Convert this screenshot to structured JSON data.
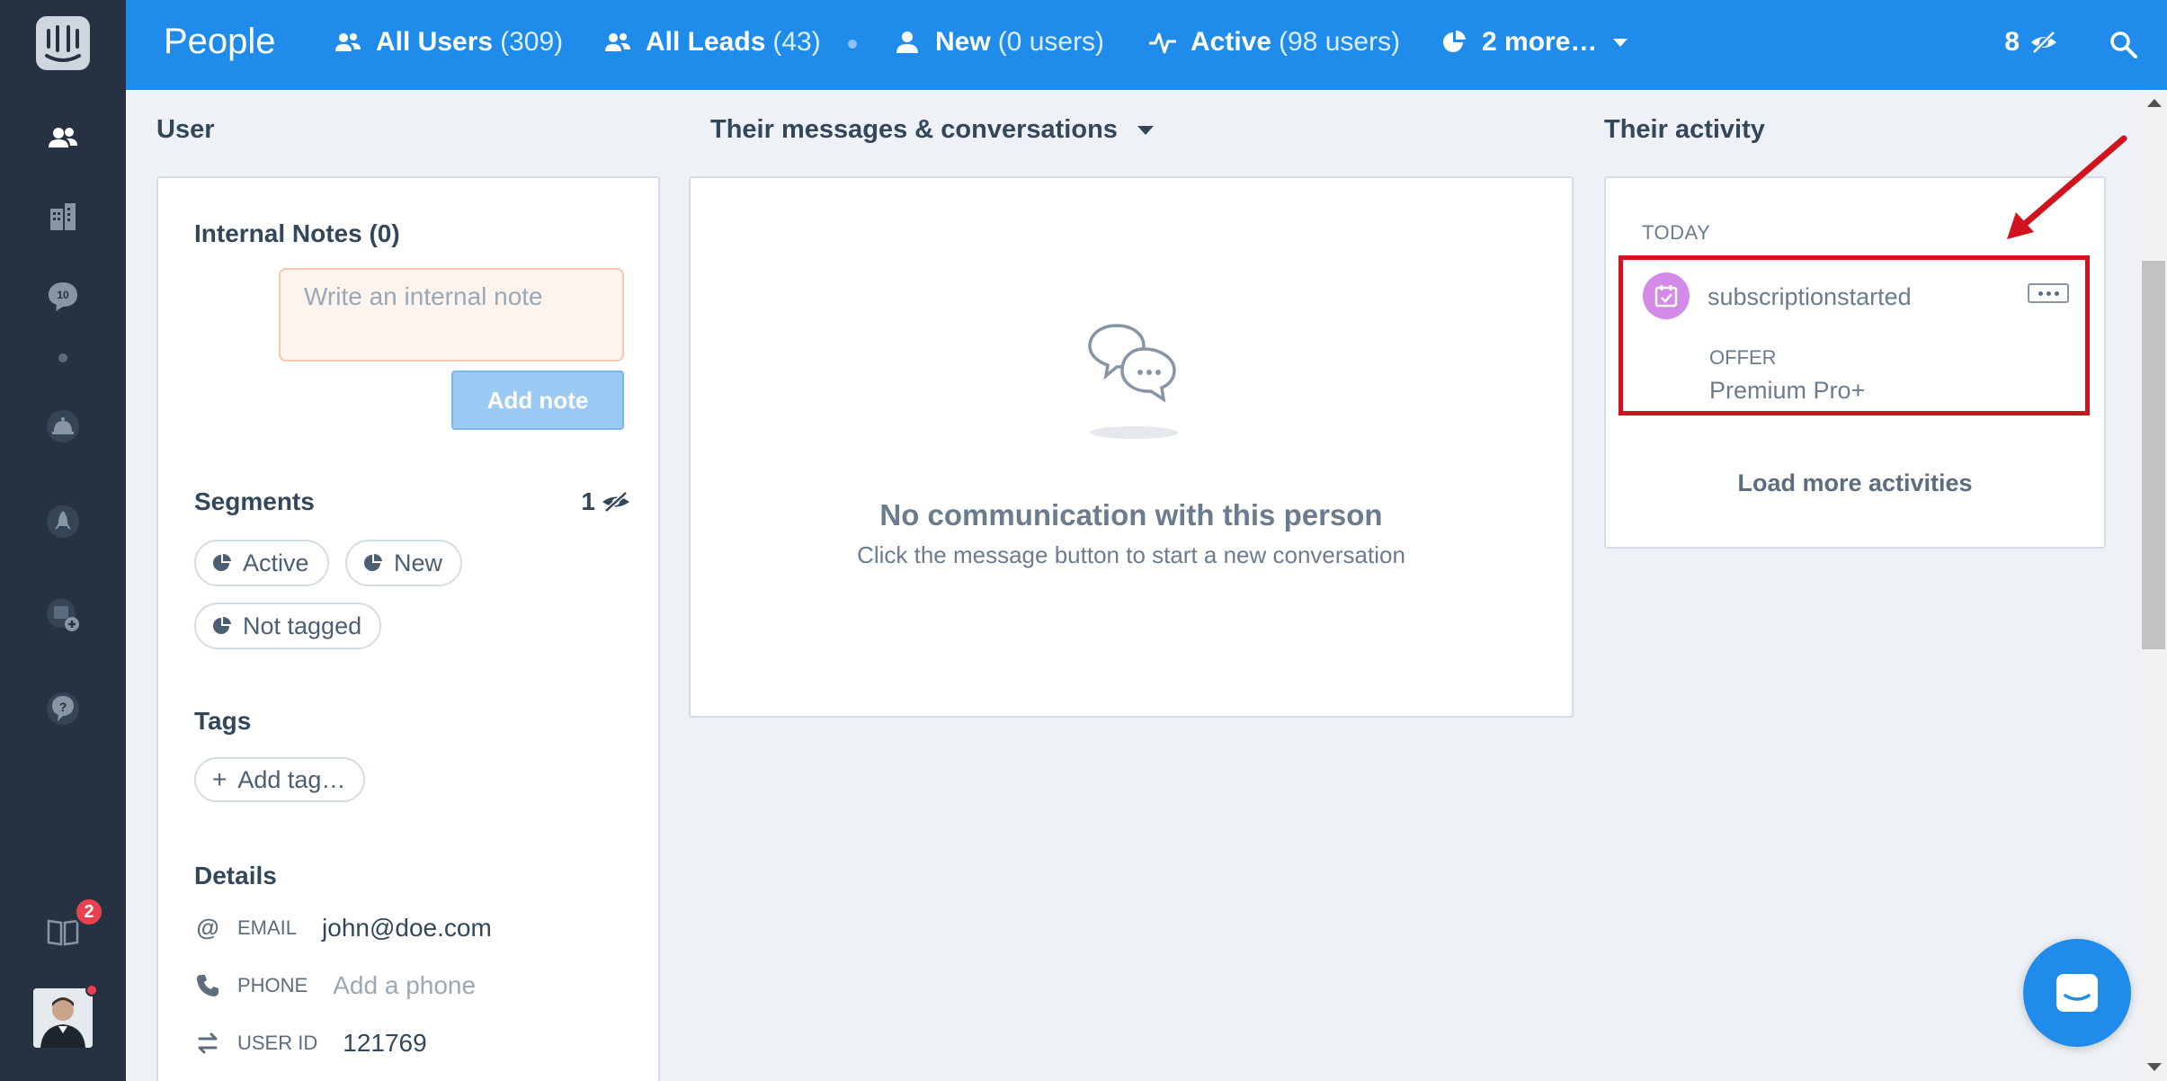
{
  "topbar": {
    "title": "People",
    "nav": [
      {
        "label": "All Users",
        "count": "(309)"
      },
      {
        "label": "All Leads",
        "count": "(43)"
      },
      {
        "label": "New",
        "count": "(0 users)"
      },
      {
        "label": "Active",
        "count": "(98 users)"
      },
      {
        "label": "2 more…",
        "count": ""
      }
    ],
    "hidden_count": "8"
  },
  "rail": {
    "inbox_badge": "10",
    "notifications_badge": "2"
  },
  "columns": {
    "user": "User",
    "messages": "Their messages & conversations",
    "activity": "Their activity"
  },
  "user_panel": {
    "notes_title": "Internal Notes (0)",
    "note_placeholder": "Write an internal note",
    "add_note": "Add note",
    "segments_title": "Segments",
    "segments_hidden_count": "1",
    "segments": [
      "Active",
      "New",
      "Not tagged"
    ],
    "tags_title": "Tags",
    "add_tag": "Add tag…",
    "details_title": "Details",
    "details": {
      "email_label": "EMAIL",
      "email_value": "john@doe.com",
      "phone_label": "PHONE",
      "phone_placeholder": "Add a phone",
      "userid_label": "USER ID",
      "userid_value": "121769"
    }
  },
  "messages_panel": {
    "empty_title": "No communication with this person",
    "empty_subtitle": "Click the message button to start a new conversation"
  },
  "activity_panel": {
    "day": "TODAY",
    "event_name": "subscriptionstarted",
    "attr_key": "OFFER",
    "attr_value": "Premium Pro+",
    "load_more": "Load more activities"
  },
  "colors": {
    "brand_blue": "#1f8ceb",
    "rail_bg": "#263241",
    "highlight_red": "#d0131f",
    "event_icon": "#d48be8"
  }
}
